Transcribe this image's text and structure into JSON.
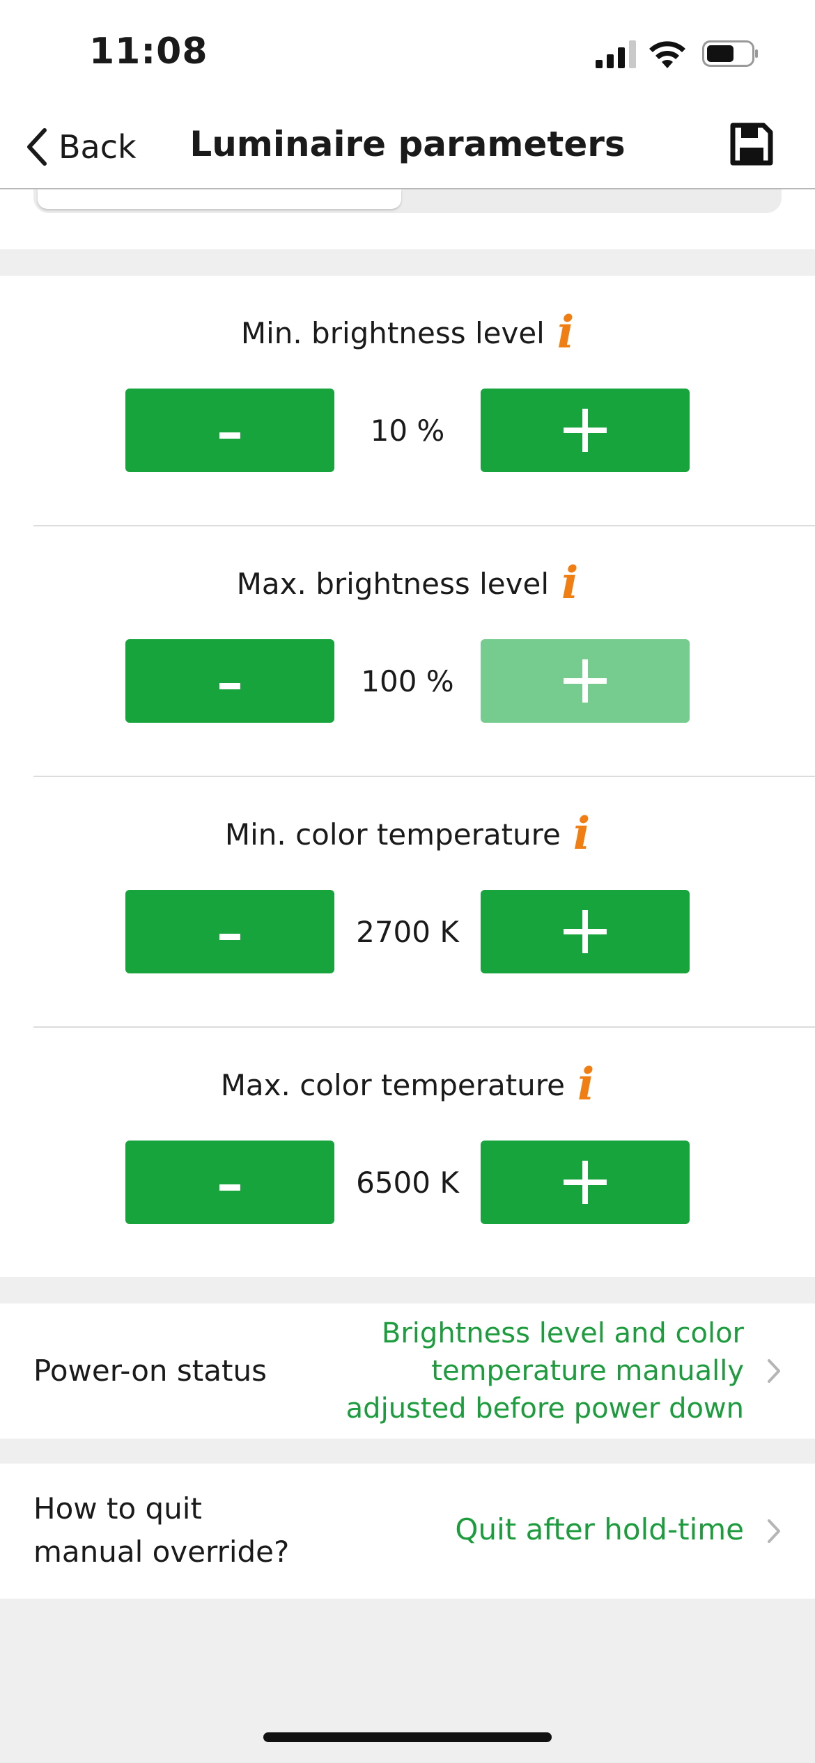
{
  "status_bar": {
    "time": "11:08"
  },
  "nav": {
    "back_label": "Back",
    "title": "Luminaire parameters"
  },
  "icons": {
    "back": "chevron-left-icon",
    "save": "floppy-disk-icon",
    "info": "info-icon",
    "chevron": "chevron-right-icon"
  },
  "colors": {
    "accent_green": "#18a43c",
    "disabled_green": "#76cb8e",
    "info_orange": "#f07e12",
    "value_green": "#1d9c3e"
  },
  "parameters": [
    {
      "label": "Min. brightness level",
      "value": "10 %",
      "minus_label": "-",
      "plus_label": "+",
      "plus_disabled": false
    },
    {
      "label": "Max. brightness level",
      "value": "100 %",
      "minus_label": "-",
      "plus_label": "+",
      "plus_disabled": true
    },
    {
      "label": "Min. color temperature",
      "value": "2700 K",
      "minus_label": "-",
      "plus_label": "+",
      "plus_disabled": false
    },
    {
      "label": "Max. color temperature",
      "value": "6500 K",
      "minus_label": "-",
      "plus_label": "+",
      "plus_disabled": false
    }
  ],
  "power_on": {
    "label": "Power-on status",
    "value_lines": [
      "Brightness level and color",
      "temperature manually",
      "adjusted before power down"
    ]
  },
  "quit_override": {
    "label_lines": [
      "How to quit",
      "manual override?"
    ],
    "value": "Quit after hold-time"
  }
}
